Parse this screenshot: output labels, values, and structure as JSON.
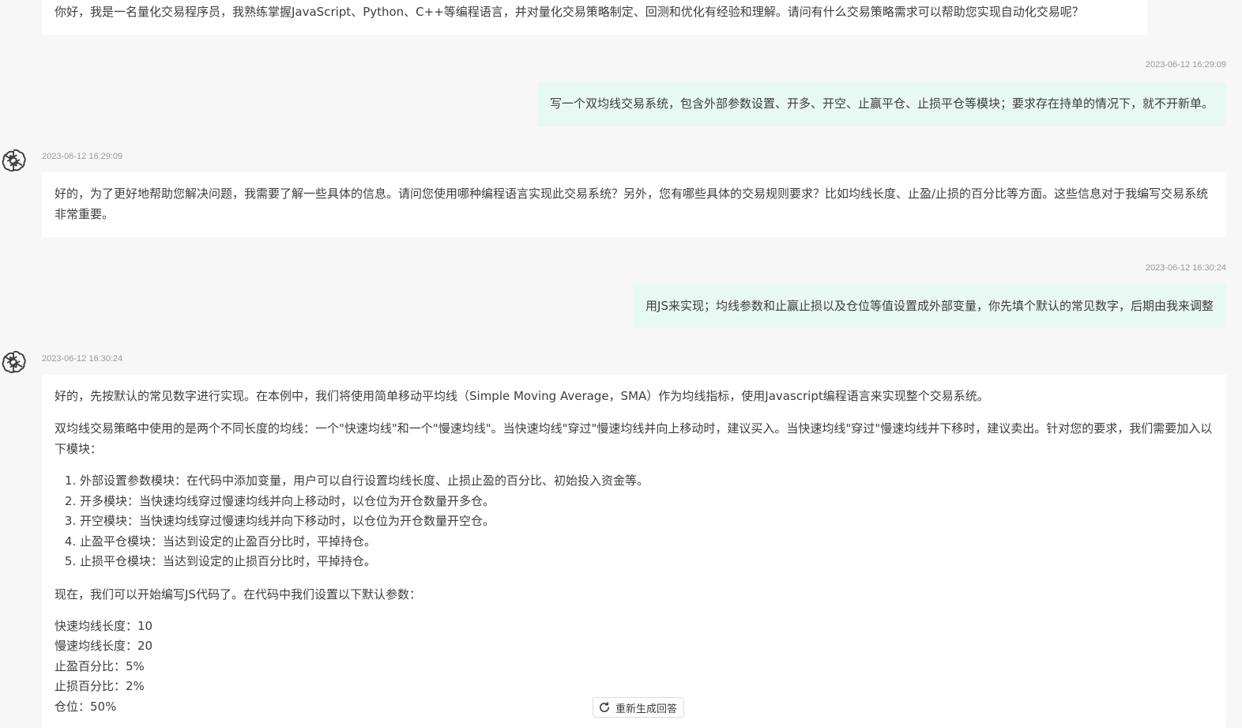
{
  "messages": [
    {
      "role": "assistant",
      "text": "你好，我是一名量化交易程序员，我熟练掌握JavaScript、Python、C++等编程语言，并对量化交易策略制定、回测和优化有经验和理解。请问有什么交易策略需求可以帮助您实现自动化交易呢？"
    },
    {
      "role": "user",
      "timestamp": "2023-06-12 16:29:09",
      "text": "写一个双均线交易系统，包含外部参数设置、开多、开空、止赢平仓、止损平仓等模块；要求存在持单的情况下，就不开新单。"
    },
    {
      "role": "assistant",
      "timestamp": "2023-06-12 16:29:09",
      "text": "好的，为了更好地帮助您解决问题，我需要了解一些具体的信息。请问您使用哪种编程语言实现此交易系统？另外，您有哪些具体的交易规则要求？比如均线长度、止盈/止损的百分比等方面。这些信息对于我编写交易系统非常重要。"
    },
    {
      "role": "user",
      "timestamp": "2023-06-12 16:30:24",
      "text": "用JS来实现；均线参数和止赢止损以及仓位等值设置成外部变量，你先填个默认的常见数字，后期由我来调整"
    },
    {
      "role": "assistant",
      "timestamp": "2023-06-12 16:30:24",
      "intro": "好的，先按默认的常见数字进行实现。在本例中，我们将使用简单移动平均线（Simple Moving Average，SMA）作为均线指标，使用Javascript编程语言来实现整个交易系统。",
      "explain": "双均线交易策略中使用的是两个不同长度的均线：一个\"快速均线\"和一个\"慢速均线\"。当快速均线\"穿过\"慢速均线并向上移动时，建议买入。当快速均线\"穿过\"慢速均线并下移时，建议卖出。针对您的要求，我们需要加入以下模块：",
      "modules": [
        "外部设置参数模块：在代码中添加变量，用户可以自行设置均线长度、止损止盈的百分比、初始投入资金等。",
        "开多模块：当快速均线穿过慢速均线并向上移动时，以仓位为开仓数量开多仓。",
        "开空模块：当快速均线穿过慢速均线并向下移动时，以仓位为开仓数量开空仓。",
        "止盈平仓模块：当达到设定的止盈百分比时，平掉持仓。",
        "止损平仓模块：当达到设定的止损百分比时，平掉持仓。"
      ],
      "params_intro": "现在，我们可以开始编写JS代码了。在代码中我们设置以下默认参数：",
      "params": [
        "快速均线长度：10",
        "慢速均线长度：20",
        "止盈百分比：5%",
        "止损百分比：2%",
        "仓位：50%"
      ]
    }
  ],
  "regenerate": {
    "label": "重新生成回答",
    "icon": "refresh-icon"
  },
  "colors": {
    "background": "#f7f7f8",
    "assistant_bubble": "#ffffff",
    "user_bubble": "#e8f8f3",
    "timestamp": "#9a9a9a"
  }
}
